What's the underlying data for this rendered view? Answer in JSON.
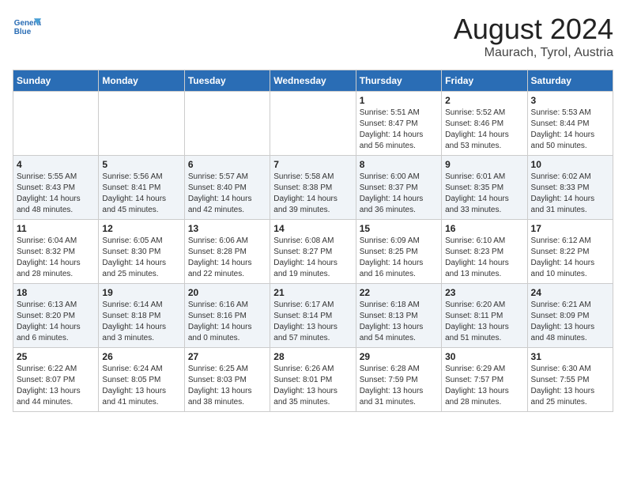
{
  "header": {
    "logo_line1": "General",
    "logo_line2": "Blue",
    "month_year": "August 2024",
    "location": "Maurach, Tyrol, Austria"
  },
  "weekdays": [
    "Sunday",
    "Monday",
    "Tuesday",
    "Wednesday",
    "Thursday",
    "Friday",
    "Saturday"
  ],
  "weeks": [
    [
      {
        "day": "",
        "info": ""
      },
      {
        "day": "",
        "info": ""
      },
      {
        "day": "",
        "info": ""
      },
      {
        "day": "",
        "info": ""
      },
      {
        "day": "1",
        "info": "Sunrise: 5:51 AM\nSunset: 8:47 PM\nDaylight: 14 hours\nand 56 minutes."
      },
      {
        "day": "2",
        "info": "Sunrise: 5:52 AM\nSunset: 8:46 PM\nDaylight: 14 hours\nand 53 minutes."
      },
      {
        "day": "3",
        "info": "Sunrise: 5:53 AM\nSunset: 8:44 PM\nDaylight: 14 hours\nand 50 minutes."
      }
    ],
    [
      {
        "day": "4",
        "info": "Sunrise: 5:55 AM\nSunset: 8:43 PM\nDaylight: 14 hours\nand 48 minutes."
      },
      {
        "day": "5",
        "info": "Sunrise: 5:56 AM\nSunset: 8:41 PM\nDaylight: 14 hours\nand 45 minutes."
      },
      {
        "day": "6",
        "info": "Sunrise: 5:57 AM\nSunset: 8:40 PM\nDaylight: 14 hours\nand 42 minutes."
      },
      {
        "day": "7",
        "info": "Sunrise: 5:58 AM\nSunset: 8:38 PM\nDaylight: 14 hours\nand 39 minutes."
      },
      {
        "day": "8",
        "info": "Sunrise: 6:00 AM\nSunset: 8:37 PM\nDaylight: 14 hours\nand 36 minutes."
      },
      {
        "day": "9",
        "info": "Sunrise: 6:01 AM\nSunset: 8:35 PM\nDaylight: 14 hours\nand 33 minutes."
      },
      {
        "day": "10",
        "info": "Sunrise: 6:02 AM\nSunset: 8:33 PM\nDaylight: 14 hours\nand 31 minutes."
      }
    ],
    [
      {
        "day": "11",
        "info": "Sunrise: 6:04 AM\nSunset: 8:32 PM\nDaylight: 14 hours\nand 28 minutes."
      },
      {
        "day": "12",
        "info": "Sunrise: 6:05 AM\nSunset: 8:30 PM\nDaylight: 14 hours\nand 25 minutes."
      },
      {
        "day": "13",
        "info": "Sunrise: 6:06 AM\nSunset: 8:28 PM\nDaylight: 14 hours\nand 22 minutes."
      },
      {
        "day": "14",
        "info": "Sunrise: 6:08 AM\nSunset: 8:27 PM\nDaylight: 14 hours\nand 19 minutes."
      },
      {
        "day": "15",
        "info": "Sunrise: 6:09 AM\nSunset: 8:25 PM\nDaylight: 14 hours\nand 16 minutes."
      },
      {
        "day": "16",
        "info": "Sunrise: 6:10 AM\nSunset: 8:23 PM\nDaylight: 14 hours\nand 13 minutes."
      },
      {
        "day": "17",
        "info": "Sunrise: 6:12 AM\nSunset: 8:22 PM\nDaylight: 14 hours\nand 10 minutes."
      }
    ],
    [
      {
        "day": "18",
        "info": "Sunrise: 6:13 AM\nSunset: 8:20 PM\nDaylight: 14 hours\nand 6 minutes."
      },
      {
        "day": "19",
        "info": "Sunrise: 6:14 AM\nSunset: 8:18 PM\nDaylight: 14 hours\nand 3 minutes."
      },
      {
        "day": "20",
        "info": "Sunrise: 6:16 AM\nSunset: 8:16 PM\nDaylight: 14 hours\nand 0 minutes."
      },
      {
        "day": "21",
        "info": "Sunrise: 6:17 AM\nSunset: 8:14 PM\nDaylight: 13 hours\nand 57 minutes."
      },
      {
        "day": "22",
        "info": "Sunrise: 6:18 AM\nSunset: 8:13 PM\nDaylight: 13 hours\nand 54 minutes."
      },
      {
        "day": "23",
        "info": "Sunrise: 6:20 AM\nSunset: 8:11 PM\nDaylight: 13 hours\nand 51 minutes."
      },
      {
        "day": "24",
        "info": "Sunrise: 6:21 AM\nSunset: 8:09 PM\nDaylight: 13 hours\nand 48 minutes."
      }
    ],
    [
      {
        "day": "25",
        "info": "Sunrise: 6:22 AM\nSunset: 8:07 PM\nDaylight: 13 hours\nand 44 minutes."
      },
      {
        "day": "26",
        "info": "Sunrise: 6:24 AM\nSunset: 8:05 PM\nDaylight: 13 hours\nand 41 minutes."
      },
      {
        "day": "27",
        "info": "Sunrise: 6:25 AM\nSunset: 8:03 PM\nDaylight: 13 hours\nand 38 minutes."
      },
      {
        "day": "28",
        "info": "Sunrise: 6:26 AM\nSunset: 8:01 PM\nDaylight: 13 hours\nand 35 minutes."
      },
      {
        "day": "29",
        "info": "Sunrise: 6:28 AM\nSunset: 7:59 PM\nDaylight: 13 hours\nand 31 minutes."
      },
      {
        "day": "30",
        "info": "Sunrise: 6:29 AM\nSunset: 7:57 PM\nDaylight: 13 hours\nand 28 minutes."
      },
      {
        "day": "31",
        "info": "Sunrise: 6:30 AM\nSunset: 7:55 PM\nDaylight: 13 hours\nand 25 minutes."
      }
    ]
  ]
}
